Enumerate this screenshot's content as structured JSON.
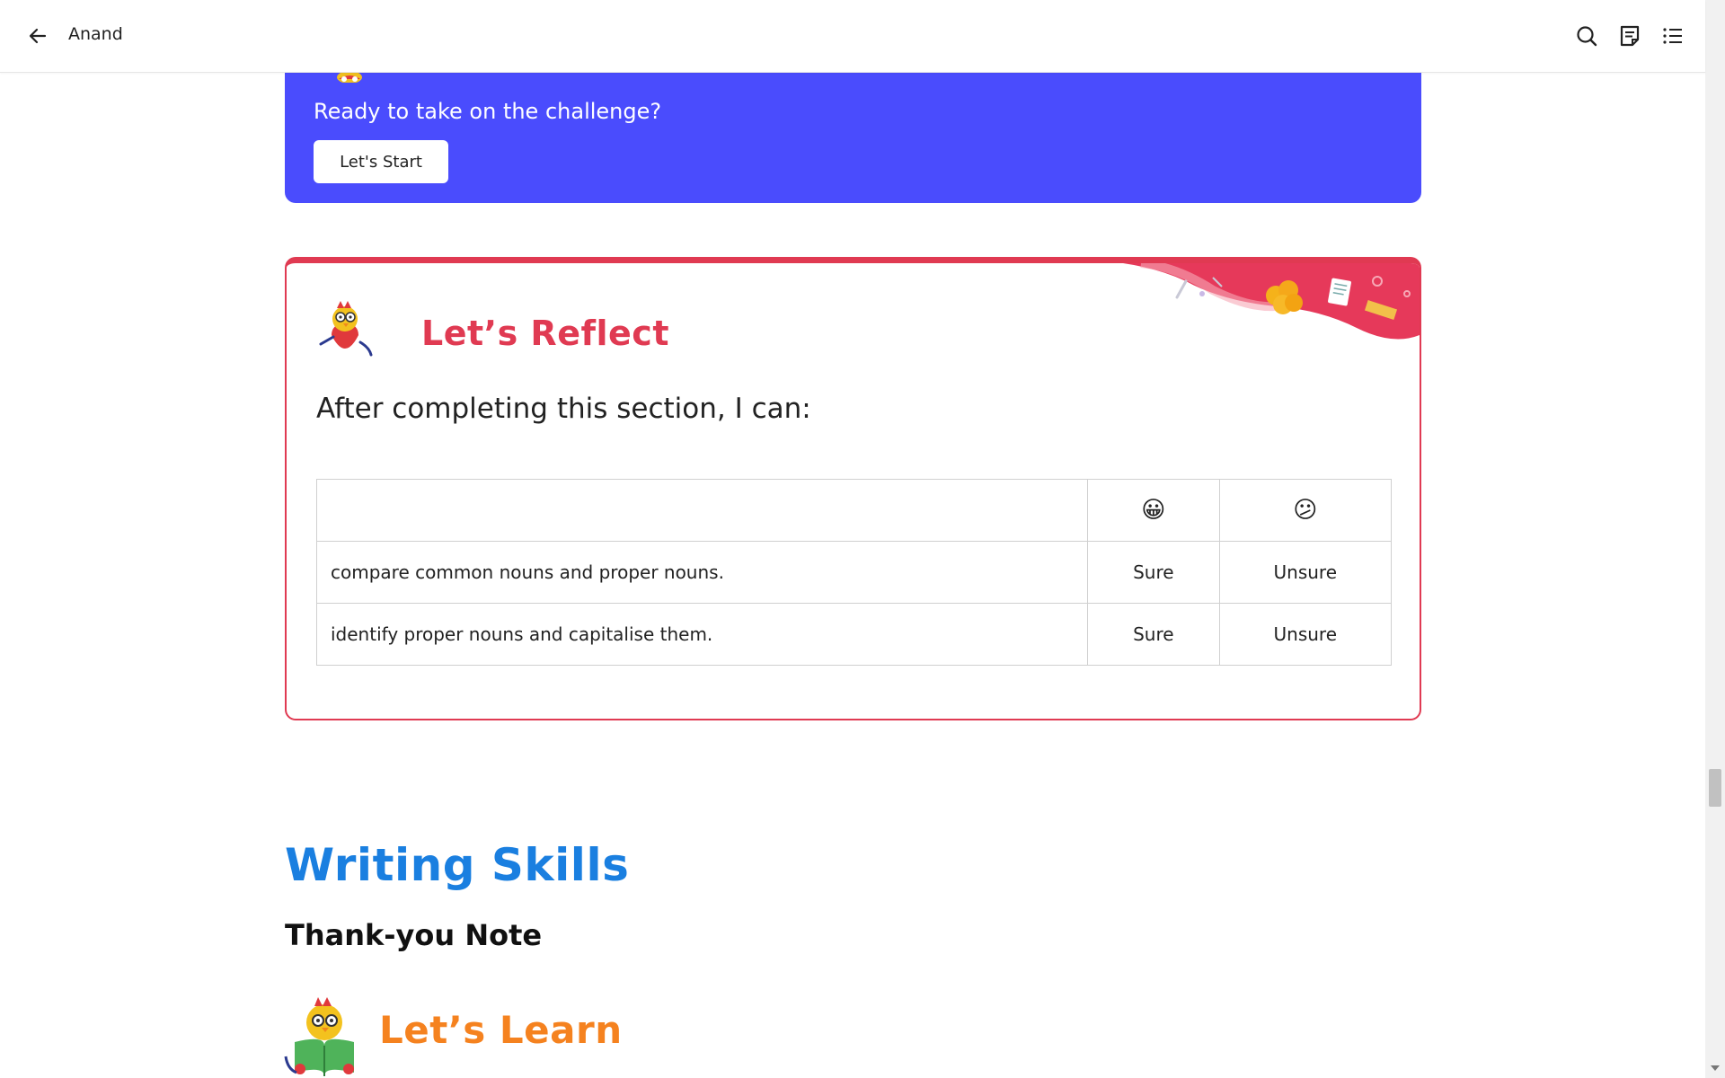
{
  "header": {
    "title": "Anand",
    "back_icon": "arrow-left-icon",
    "search_icon": "search-icon",
    "notes_icon": "notes-icon",
    "toc_icon": "list-icon"
  },
  "challenge": {
    "prompt": "Ready to take on the challenge?",
    "start_label": "Let's Start",
    "background_color": "#4a4cfd"
  },
  "reflect": {
    "heading": "Let’s Reflect",
    "subtitle": "After completing this section, I can:",
    "accent_color": "#e03a52",
    "table": {
      "header": {
        "statement": "",
        "sure_emoji": "😀",
        "unsure_emoji": "😕"
      },
      "rows": [
        {
          "statement": "compare common nouns and proper nouns.",
          "sure": "Sure",
          "unsure": "Unsure"
        },
        {
          "statement": "identify proper nouns and capitalise them.",
          "sure": "Sure",
          "unsure": "Unsure"
        }
      ]
    }
  },
  "writing_skills": {
    "title": "Writing Skills",
    "subtitle": "Thank-you Note",
    "title_color": "#1a7fe0"
  },
  "learn": {
    "heading": "Let’s Learn",
    "accent_color": "#f5821f"
  }
}
